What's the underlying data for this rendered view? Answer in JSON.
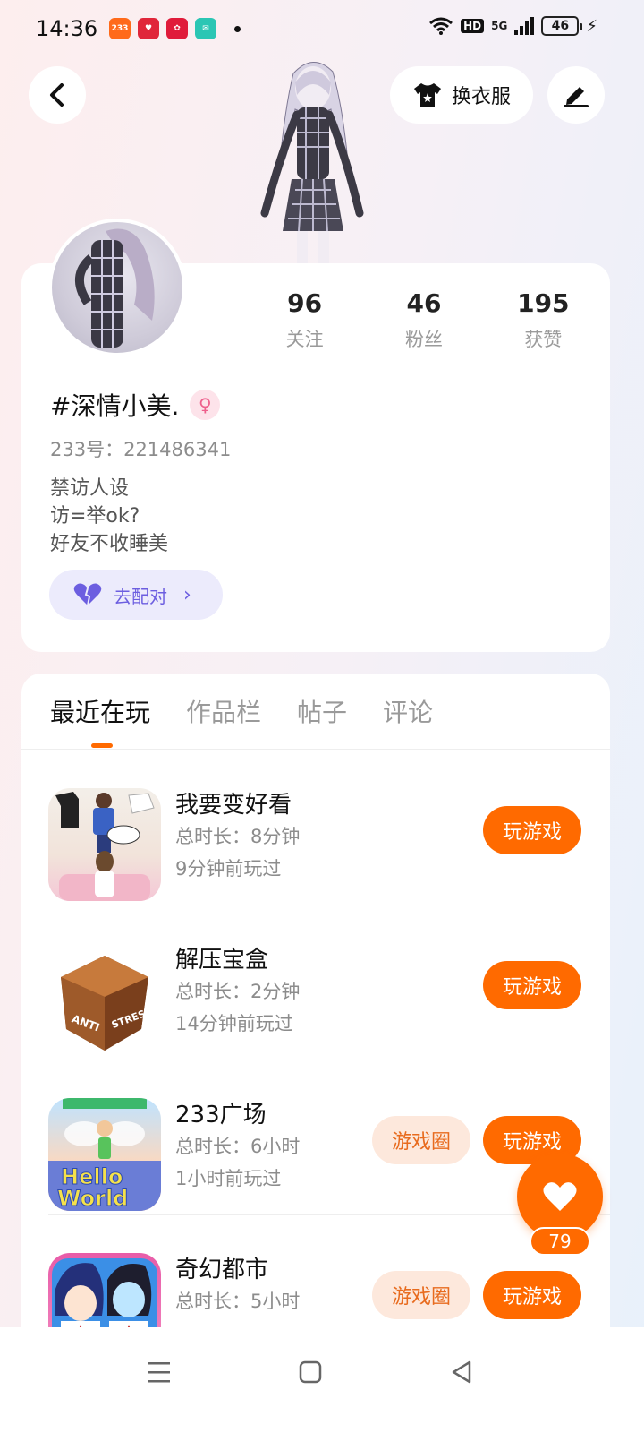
{
  "status_bar": {
    "time": "14:36",
    "notifications": [
      "233",
      "",
      "",
      ""
    ],
    "hd_label": "HD",
    "network_label": "5G",
    "battery": "46"
  },
  "header": {
    "outfit_label": "换衣服"
  },
  "profile": {
    "stats": [
      {
        "value": "96",
        "label": "关注"
      },
      {
        "value": "46",
        "label": "粉丝"
      },
      {
        "value": "195",
        "label": "获赞"
      }
    ],
    "username": "#深情小美.",
    "uid": "233号：221486341",
    "bio": [
      "禁访人设",
      "访=举ok?",
      "好友不收睡美"
    ],
    "match_label": "去配对"
  },
  "tabs": [
    "最近在玩",
    "作品栏",
    "帖子",
    "评论"
  ],
  "games": [
    {
      "name": "我要变好看",
      "duration": "总时长：8分钟",
      "last_played": "9分钟前玩过",
      "play_label": "玩游戏"
    },
    {
      "name": "解压宝盒",
      "duration": "总时长：2分钟",
      "last_played": "14分钟前玩过",
      "play_label": "玩游戏"
    },
    {
      "name": "233广场",
      "duration": "总时长：6小时",
      "last_played": "1小时前玩过",
      "play_label": "玩游戏",
      "circle_label": "游戏圈"
    },
    {
      "name": "奇幻都市",
      "duration": "总时长：5小时",
      "last_played": "",
      "play_label": "玩游戏",
      "circle_label": "游戏圈"
    }
  ],
  "float_like": {
    "count": "79"
  },
  "colors": {
    "accent": "#ff6a00",
    "match": "#6c5ee0"
  }
}
